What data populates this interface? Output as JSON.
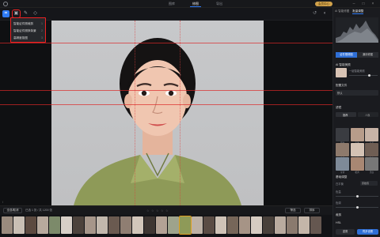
{
  "topbar": {
    "tabs": [
      {
        "label": "图库"
      },
      {
        "label": "修图"
      },
      {
        "label": "导出"
      }
    ],
    "vip_label": "会员中心",
    "window_controls": [
      "minimize-icon",
      "maximize-icon",
      "close-icon"
    ]
  },
  "toolbar": {
    "tools": [
      "crop-icon",
      "id-photo-icon",
      "brush-icon",
      "eraser-icon"
    ],
    "right_tools": [
      "undo-icon",
      "compare-icon"
    ]
  },
  "menu": {
    "items": [
      {
        "label": "智能证件照裁剪",
        "shortcut": "1"
      },
      {
        "label": "智能证件照换背景",
        "shortcut": "2"
      },
      {
        "label": "高精度抠图",
        "shortcut": "3"
      }
    ]
  },
  "bottombar": {
    "select_all": "全选/取消",
    "count": "已选 1 张 / 共 1200 张",
    "stars": 5,
    "filter_label": "筛选",
    "sort_label": "排序"
  },
  "rpanel": {
    "tabs": [
      {
        "label": "AI 智能修图"
      },
      {
        "label": "批量调整"
      }
    ],
    "seg": [
      {
        "label": "证件照修图"
      },
      {
        "label": "通用修图"
      }
    ],
    "section_ai": "AI 智能美颜",
    "section_ai_sub": "一键智能美颜",
    "section_preset": "配置文件",
    "preset_value": "默认",
    "section_filter": "滤镜",
    "filter_tabs": [
      {
        "label": "推荐"
      },
      {
        "label": "人像"
      }
    ],
    "filter_items": [
      {
        "label": "原图",
        "color": "#3a3c41"
      },
      {
        "label": "清透",
        "color": "#b79c8a"
      },
      {
        "label": "日系",
        "color": "#c7b3a6"
      },
      {
        "label": "自然",
        "color": "#8e7a6c"
      },
      {
        "label": "奶油",
        "color": "#d4c2b4"
      },
      {
        "label": "胶片",
        "color": "#6f5e54"
      },
      {
        "label": "冷调",
        "color": "#7e8a98"
      },
      {
        "label": "暖调",
        "color": "#a88773"
      },
      {
        "label": "黑白",
        "color": "#777"
      }
    ],
    "section_adjust": "基础调整",
    "adjust_items": [
      {
        "label": "白平衡",
        "value": "原始值"
      },
      {
        "label": "色温"
      },
      {
        "label": "色调"
      }
    ],
    "section_crop": "裁剪",
    "section_hsl": "HSL",
    "button_reset": "重置",
    "button_apply": "同步设置"
  },
  "colors": {
    "accent": "#2f7bf6",
    "highlight": "#e22222",
    "background": "#111214"
  }
}
